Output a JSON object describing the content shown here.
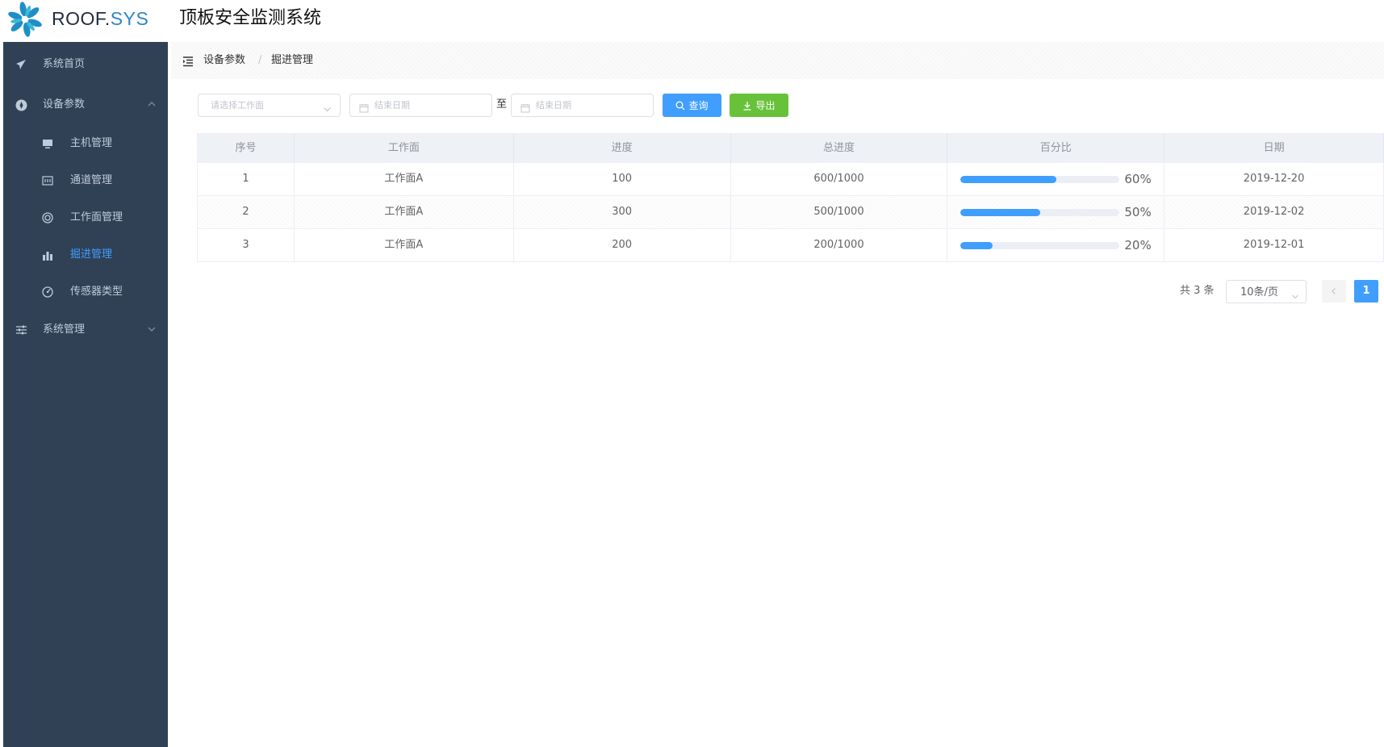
{
  "header": {
    "logo_text_main": "ROOF.",
    "logo_text_accent": "SYS",
    "app_title": "顶板安全监测系统",
    "accent_color": "#2e86c9"
  },
  "sidebar": {
    "background": "#304156",
    "active_color": "#409eff",
    "items": [
      {
        "label": "系统首页",
        "icon": "paper-plane-icon"
      },
      {
        "label": "设备参数",
        "icon": "settings-disc-icon",
        "expanded": true,
        "children": [
          {
            "label": "主机管理",
            "icon": "monitor-icon"
          },
          {
            "label": "通道管理",
            "icon": "channel-icon"
          },
          {
            "label": "工作面管理",
            "icon": "life-ring-icon"
          },
          {
            "label": "掘进管理",
            "icon": "bar-chart-icon",
            "active": true
          },
          {
            "label": "传感器类型",
            "icon": "gauge-icon"
          }
        ]
      },
      {
        "label": "系统管理",
        "icon": "sliders-icon",
        "expanded": false
      }
    ]
  },
  "breadcrumb": {
    "items": [
      "设备参数",
      "掘进管理"
    ],
    "separator": "/"
  },
  "filters": {
    "workface_placeholder": "请选择工作面",
    "start_date_placeholder": "结束日期",
    "to_label": "至",
    "end_date_placeholder": "结束日期",
    "query_label": "查询",
    "export_label": "导出"
  },
  "table": {
    "columns": [
      "序号",
      "工作面",
      "进度",
      "总进度",
      "百分比",
      "日期"
    ],
    "rows": [
      {
        "index": "1",
        "workface": "工作面A",
        "progress": "100",
        "total": "600/1000",
        "percent": 60,
        "percent_label": "60%",
        "date": "2019-12-20"
      },
      {
        "index": "2",
        "workface": "工作面A",
        "progress": "300",
        "total": "500/1000",
        "percent": 50,
        "percent_label": "50%",
        "date": "2019-12-02"
      },
      {
        "index": "3",
        "workface": "工作面A",
        "progress": "200",
        "total": "200/1000",
        "percent": 20,
        "percent_label": "20%",
        "date": "2019-12-01"
      }
    ]
  },
  "pagination": {
    "total_label": "共 3 条",
    "page_size": "10条/页",
    "current_page": "1"
  }
}
